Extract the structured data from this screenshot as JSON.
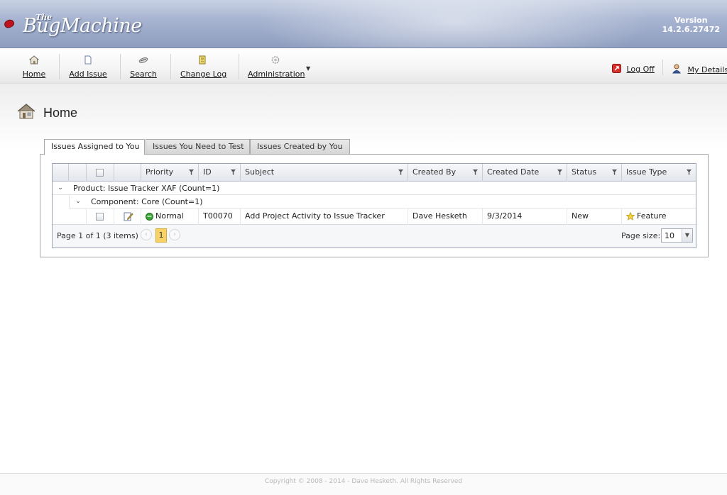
{
  "app": {
    "logo_the": "The",
    "logo_name": "BugMachine",
    "version_label": "Version",
    "version_number": "14.2.6.27472"
  },
  "toolbar": {
    "home": "Home",
    "add_issue": "Add Issue",
    "search": "Search",
    "change_log": "Change Log",
    "administration": "Administration",
    "log_off": "Log Off",
    "my_details": "My Details"
  },
  "page": {
    "title": "Home"
  },
  "tabs": [
    {
      "label": "Issues Assigned to You",
      "active": true
    },
    {
      "label": "Issues You Need to Test",
      "active": false
    },
    {
      "label": "Issues Created by You",
      "active": false
    }
  ],
  "grid": {
    "columns": [
      "Priority",
      "ID",
      "Subject",
      "Created By",
      "Created Date",
      "Status",
      "Issue Type"
    ],
    "group_product": "Product: Issue Tracker XAF (Count=1)",
    "group_component": "Component: Core (Count=1)",
    "rows": [
      {
        "priority": "Normal",
        "id": "T00070",
        "subject": "Add Project Activity to Issue Tracker",
        "created_by": "Dave Hesketh",
        "created_date": "9/3/2014",
        "status": "New",
        "issue_type": "Feature"
      }
    ],
    "pager": {
      "info": "Page 1 of 1 (3 items)",
      "current_page": "1",
      "page_size_label": "Page size:",
      "page_size": "10"
    }
  },
  "footer": {
    "copyright": "Copyright © 2008 - 2014 - Dave Hesketh. All Rights Reserved"
  },
  "colors": {
    "header_top": "#c9d2e4",
    "header_bottom": "#8e9dbf",
    "priority_normal": "#3aa636",
    "pager_current": "#f6d267"
  }
}
